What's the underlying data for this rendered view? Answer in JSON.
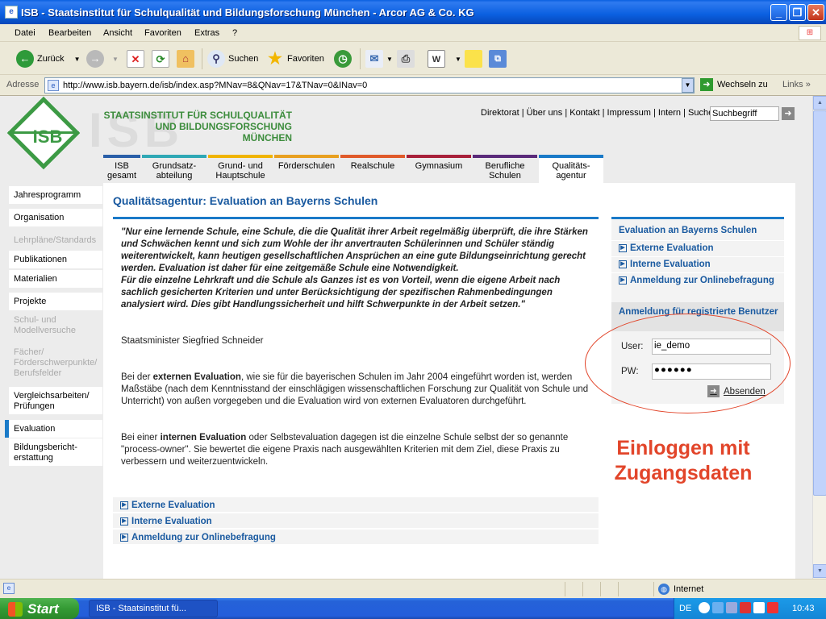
{
  "window": {
    "title": "ISB - Staatsinstitut für Schulqualität und Bildungsforschung München - Arcor AG & Co. KG"
  },
  "menu": [
    "Datei",
    "Bearbeiten",
    "Ansicht",
    "Favoriten",
    "Extras",
    "?"
  ],
  "toolbar": {
    "back": "Zurück",
    "search": "Suchen",
    "favorites": "Favoriten"
  },
  "address": {
    "label": "Adresse",
    "url": "http://www.isb.bayern.de/isb/index.asp?MNav=8&QNav=17&TNav=0&INav=0",
    "go": "Wechseln zu",
    "links": "Links"
  },
  "site": {
    "logo": "ISB",
    "watermark": "ISB",
    "name_line1": "STAATSINSTITUT FÜR SCHULQUALITÄT",
    "name_line2": "UND BILDUNGSFORSCHUNG",
    "name_line3": "MÜNCHEN",
    "toplinks": "Direktorat | Über uns | Kontakt | Impressum | Intern | Suche",
    "search_value": "Suchbegriff"
  },
  "tabs": [
    {
      "l1": "ISB",
      "l2": "gesamt",
      "color": "#2a5fa8"
    },
    {
      "l1": "Grundsatz-",
      "l2": "abteilung",
      "color": "#2fa8b5"
    },
    {
      "l1": "Grund- und",
      "l2": "Hauptschule",
      "color": "#f0b400"
    },
    {
      "l1": "Förderschulen",
      "l2": "",
      "color": "#e8a020"
    },
    {
      "l1": "Realschule",
      "l2": "",
      "color": "#e05a2a"
    },
    {
      "l1": "Gymnasium",
      "l2": "",
      "color": "#a8203a"
    },
    {
      "l1": "Berufliche",
      "l2": "Schulen",
      "color": "#5a2a7a"
    },
    {
      "l1": "Qualitäts-",
      "l2": "agentur",
      "color": "#1a7ac8"
    }
  ],
  "nav": [
    {
      "l1": "Jahresprogramm",
      "l2": ""
    },
    {
      "l1": "Organisation",
      "l2": ""
    },
    {
      "l1": "Lehrpläne/Standards",
      "l2": ""
    },
    {
      "l1": "Publikationen",
      "l2": ""
    },
    {
      "l1": "Materialien",
      "l2": ""
    },
    {
      "l1": "Projekte",
      "l2": ""
    },
    {
      "l1": "Schul- und",
      "l2": "Modellversuche"
    },
    {
      "l1": "Fächer/",
      "l2": "Förderschwerpunkte/",
      "l3": "Berufsfelder"
    },
    {
      "l1": "Vergleichsarbeiten/",
      "l2": "Prüfungen"
    },
    {
      "l1": "Evaluation",
      "l2": ""
    },
    {
      "l1": "Bildungsbericht-",
      "l2": "erstattung"
    }
  ],
  "main": {
    "heading": "Qualitätsagentur: Evaluation an Bayerns Schulen",
    "quote": "\"Nur eine lernende Schule, eine Schule, die die Qualität ihrer Arbeit regelmäßig überprüft, die ihre Stärken und Schwächen kennt und sich zum Wohle der ihr anvertrauten Schülerinnen und Schüler ständig weiterentwickelt, kann heutigen gesellschaftlichen Ansprüchen an eine gute Bildungseinrichtung gerecht werden. Evaluation ist daher für eine zeitgemäße Schule eine Notwendigkeit.",
    "quote2": "Für die einzelne Lehrkraft und die Schule als Ganzes ist es von Vorteil, wenn die eigene Arbeit nach sachlich gesicherten Kriterien und unter Berücksichtigung der spezifischen Rahmenbedingungen analysiert wird. Dies gibt Handlungssicherheit und hilft Schwerpunkte in der Arbeit setzen.\"",
    "minister": "Staatsminister Siegfried Schneider",
    "p1_a": "Bei der ",
    "p1_b": "externen Evaluation",
    "p1_c": ", wie sie für die bayerischen Schulen im Jahr 2004 eingeführt worden ist, werden Maßstäbe (nach dem Kenntnisstand der einschlägigen wissenschaftlichen Forschung zur Qualität von Schule und Unterricht) von außen vorgegeben und die Evaluation wird von externen Evaluatoren durchgeführt.",
    "p2_a": "Bei einer ",
    "p2_b": "internen Evaluation",
    "p2_c": " oder Selbstevaluation dagegen ist die einzelne Schule selbst der so genannte \"process-owner\". Sie bewertet die eigene Praxis nach ausgewählten Kriterien mit dem Ziel, diese Praxis zu verbessern und weiterzuentwickeln.",
    "links": [
      "Externe Evaluation",
      "Interne Evaluation",
      "Anmeldung zur Onlinebefragung"
    ]
  },
  "sidebox": {
    "title": "Evaluation an Bayerns Schulen",
    "links": [
      "Externe Evaluation",
      "Interne Evaluation",
      "Anmeldung zur Onlinebefragung"
    ],
    "reg": "Anmeldung für registrierte Benutzer",
    "user_label": "User:",
    "user_value": "ie_demo",
    "pw_label": "PW:",
    "pw_value": "●●●●●●",
    "submit": "Absenden"
  },
  "annotation": {
    "l1": "Einloggen mit",
    "l2": "Zugangsdaten"
  },
  "status": {
    "zone": "Internet"
  },
  "taskbar": {
    "start": "Start",
    "item": "ISB - Staatsinstitut fü...",
    "lang": "DE",
    "time": "10:43"
  }
}
